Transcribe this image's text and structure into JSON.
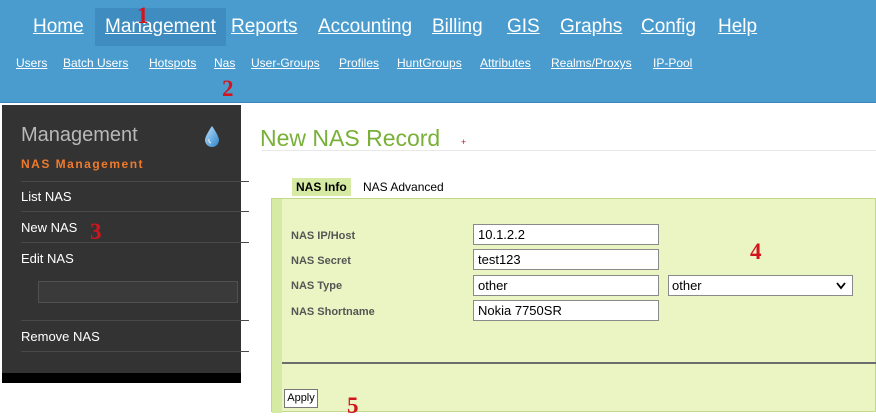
{
  "main_nav": [
    {
      "label": "Home"
    },
    {
      "label": "Management",
      "active": true
    },
    {
      "label": "Reports"
    },
    {
      "label": "Accounting"
    },
    {
      "label": "Billing"
    },
    {
      "label": "GIS"
    },
    {
      "label": "Graphs"
    },
    {
      "label": "Config"
    },
    {
      "label": "Help"
    }
  ],
  "sub_nav": [
    {
      "label": "Users"
    },
    {
      "label": "Batch Users"
    },
    {
      "label": "Hotspots"
    },
    {
      "label": "Nas"
    },
    {
      "label": "User-Groups"
    },
    {
      "label": "Profiles"
    },
    {
      "label": "HuntGroups"
    },
    {
      "label": "Attributes"
    },
    {
      "label": "Realms/Proxys"
    },
    {
      "label": "IP-Pool"
    }
  ],
  "sidebar": {
    "title": "Management",
    "subtitle": "NAS Management",
    "items": [
      {
        "label": "List NAS"
      },
      {
        "label": "New NAS"
      },
      {
        "label": "Edit NAS"
      },
      {
        "label": "Remove NAS"
      }
    ],
    "edit_input_value": "",
    "icon": "water-drop-icon"
  },
  "page": {
    "title": "New NAS Record",
    "title_marker": "+"
  },
  "tabs": [
    {
      "label": "NAS Info",
      "active": true
    },
    {
      "label": "NAS Advanced"
    }
  ],
  "form": {
    "fields": [
      {
        "label": "NAS IP/Host",
        "value": "10.1.2.2"
      },
      {
        "label": "NAS Secret",
        "value": "test123"
      },
      {
        "label": "NAS Type",
        "value": "other"
      },
      {
        "label": "NAS Shortname",
        "value": "Nokia 7750SR"
      }
    ],
    "type_select": {
      "selected": "other"
    },
    "apply_label": "Apply"
  },
  "annotations": [
    "1",
    "2",
    "3",
    "4",
    "5"
  ],
  "colors": {
    "topbar": "#4a9ccf",
    "sidebar": "#333333",
    "title_green": "#79b038",
    "form_bg": "#ebf5c3",
    "accent_orange": "#f07a2c",
    "marker_red": "#d4141c"
  }
}
